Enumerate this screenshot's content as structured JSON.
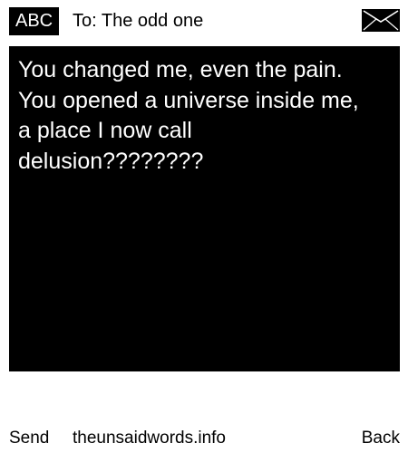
{
  "header": {
    "mode_label": "ABC",
    "recipient": "To: The odd one",
    "icon": "envelope-icon"
  },
  "message": {
    "text": "You changed me, even the pain.\nYou opened a universe inside me,\na place I now call\ndelusion????????"
  },
  "footer": {
    "left_softkey": "Send",
    "site": "theunsaidwords.info",
    "right_softkey": "Back"
  },
  "colors": {
    "background": "#ffffff",
    "message_background": "#000000",
    "message_text": "#ffffff",
    "text": "#000000"
  }
}
